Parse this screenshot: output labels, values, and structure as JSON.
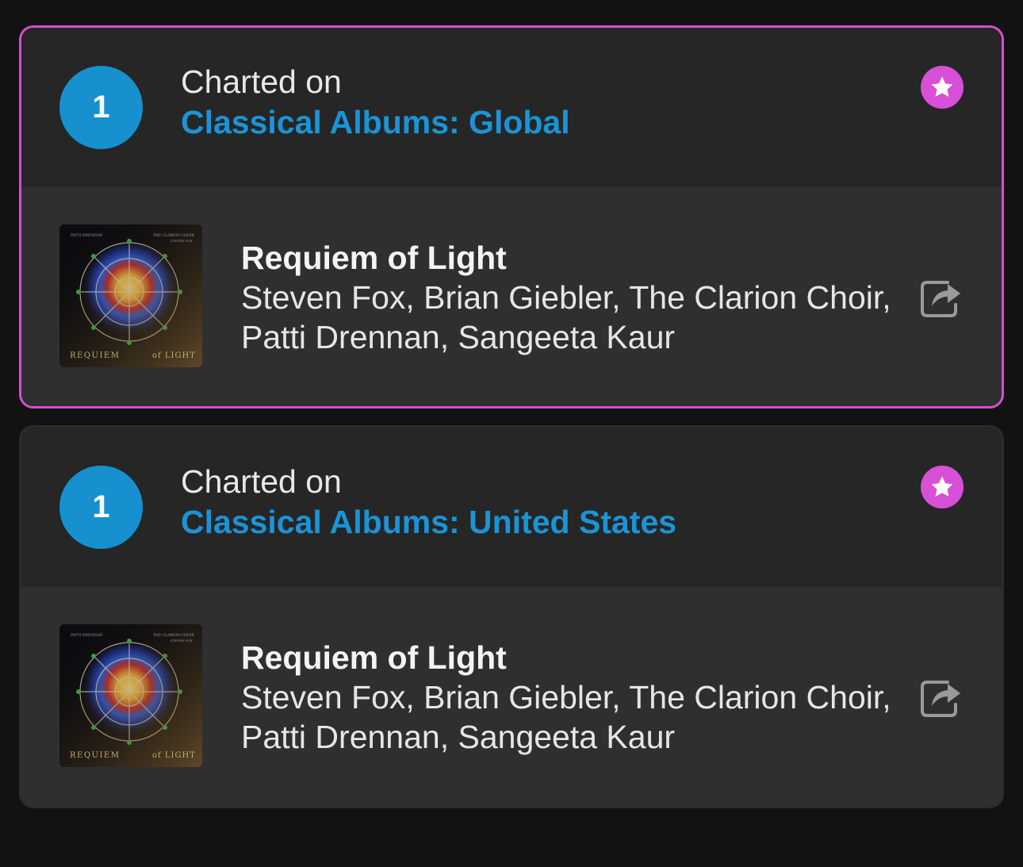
{
  "entries": [
    {
      "rank": "1",
      "charted_on_label": "Charted on",
      "chart_name": "Classical Albums: Global",
      "highlighted": true,
      "album": {
        "title": "Requiem of Light",
        "artists_line1": "Steven Fox, Brian Giebler, The Clarion Choir,",
        "artists_line2": "Patti Drennan, Sangeeta Kaur",
        "cover_text_top_left": "PATTI DRENNAN",
        "cover_text_top_right": "THE CLARION CHOIR",
        "cover_text_top_right_sub": "STEVEN FOX",
        "cover_text_bottom_left": "REQUIEM",
        "cover_text_bottom_right": "of LIGHT"
      }
    },
    {
      "rank": "1",
      "charted_on_label": "Charted on",
      "chart_name": "Classical Albums: United States",
      "highlighted": false,
      "album": {
        "title": "Requiem of Light",
        "artists_line1": "Steven Fox, Brian Giebler, The Clarion Choir,",
        "artists_line2": "Patti Drennan, Sangeeta Kaur",
        "cover_text_top_left": "PATTI DRENNAN",
        "cover_text_top_right": "THE CLARION CHOIR",
        "cover_text_top_right_sub": "STEVEN FOX",
        "cover_text_bottom_left": "REQUIEM",
        "cover_text_bottom_right": "of LIGHT"
      }
    }
  ],
  "icons": {
    "star": "star-icon",
    "share": "share-icon"
  },
  "colors": {
    "background": "#121212",
    "card": "#2c2c2c",
    "rank_badge": "#1690cf",
    "chart_link": "#1a94d6",
    "accent_magenta": "#d84fd8"
  }
}
